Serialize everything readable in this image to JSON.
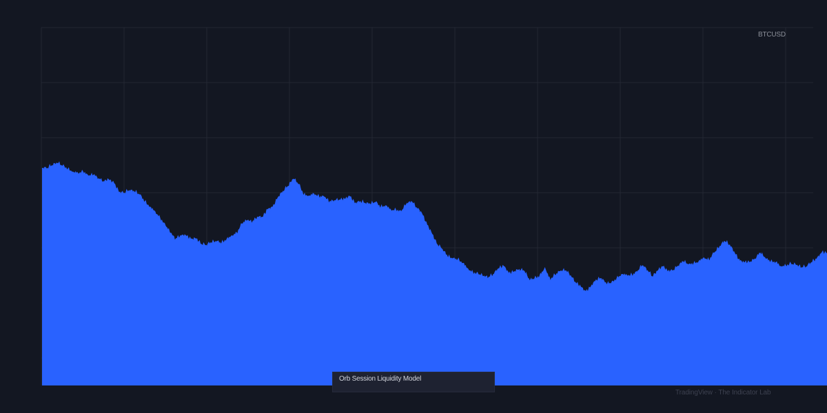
{
  "symbol": "BTCUSD",
  "caption": "Orb Session Liquidity Model",
  "credit": "TradingView · The Indicator Lab",
  "colors": {
    "background": "#131722",
    "grid": "#232733",
    "area_fill": "#2962ff",
    "area_line": "#2962ff"
  },
  "chart_data": {
    "type": "area",
    "title": "",
    "xlabel": "",
    "ylabel": "",
    "ylim": [
      0,
      100
    ],
    "grid": true,
    "legend": "none",
    "series": [
      {
        "values": [
          60.6,
          60.6,
          61.4,
          62.0,
          61.2,
          60.3,
          59.6,
          59.2,
          59.5,
          58.4,
          58.7,
          57.7,
          56.9,
          57.4,
          56.4,
          53.8,
          53.7,
          54.4,
          54.0,
          53.2,
          51.2,
          49.8,
          48.5,
          46.5,
          44.6,
          42.5,
          40.7,
          41.8,
          41.8,
          40.7,
          40.9,
          39.4,
          39.1,
          39.8,
          40.1,
          39.6,
          40.7,
          41.8,
          42.4,
          45.1,
          46.0,
          45.5,
          47.0,
          46.9,
          49.1,
          49.7,
          52.4,
          54.2,
          55.6,
          57.6,
          56.1,
          53.1,
          52.9,
          53.4,
          52.5,
          52.6,
          51.1,
          51.6,
          51.8,
          51.9,
          52.7,
          50.7,
          51.3,
          50.8,
          50.5,
          51.1,
          49.6,
          50.2,
          48.9,
          48.8,
          48.4,
          50.5,
          51.3,
          49.6,
          48.0,
          44.8,
          42.2,
          39.3,
          38.0,
          35.9,
          35.3,
          35.0,
          34.1,
          32.5,
          31.3,
          31.0,
          30.4,
          30.0,
          31.0,
          32.6,
          33.2,
          31.1,
          31.7,
          32.3,
          31.8,
          29.2,
          29.7,
          30.4,
          32.7,
          29.4,
          30.7,
          31.8,
          32.0,
          30.6,
          28.6,
          27.4,
          26.0,
          27.5,
          29.4,
          29.8,
          28.2,
          28.5,
          29.6,
          31.0,
          30.7,
          30.6,
          31.6,
          33.4,
          32.0,
          30.3,
          31.9,
          33.1,
          31.7,
          32.1,
          33.3,
          34.5,
          33.6,
          33.8,
          34.5,
          35.6,
          34.8,
          36.9,
          38.4,
          40.2,
          39.2,
          36.8,
          34.6,
          34.2,
          34.4,
          35.3,
          36.9,
          35.3,
          34.4,
          34.3,
          33.2,
          33.3,
          33.8,
          33.5,
          32.8,
          33.1,
          34.3,
          35.2,
          37.0,
          36.9
        ]
      }
    ]
  }
}
